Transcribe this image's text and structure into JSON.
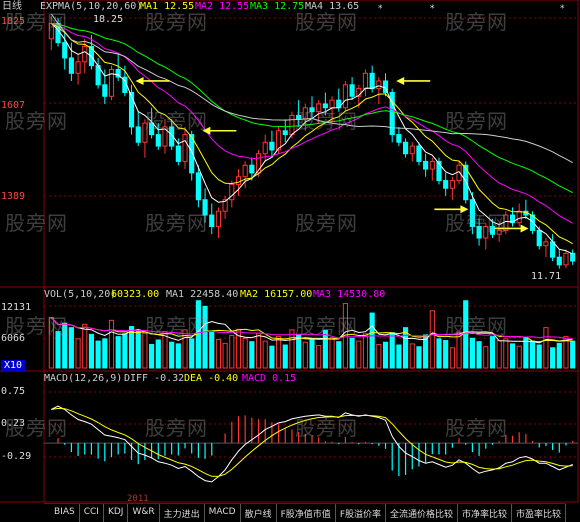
{
  "chart_title": {
    "period": "日线",
    "ma_header": "EXPMA(5,10,20,60)",
    "ma1": "MA1 12.55",
    "ma2": "MA2 12.55",
    "ma3": "MA3 12.75",
    "ma4": "MA4 13.65"
  },
  "price_axis": {
    "top": "1825",
    "mid": "1607",
    "low": "1389"
  },
  "price_annotations": {
    "high": "18.25",
    "low": "11.71"
  },
  "volume_header": {
    "name": "VOL(5,10,20)",
    "vol": "60323.00",
    "ma1": "MA1 22458.40",
    "ma2": "MA2 16157.00",
    "ma3": "MA3 14530.80"
  },
  "volume_axis": {
    "top": "12131",
    "mid": "6066",
    "unit": "X10"
  },
  "macd_header": {
    "name": "MACD(12,26,9)",
    "diff": "DIFF -0.32",
    "dea": "DEA -0.40",
    "macd": "MACD 0.15"
  },
  "macd_axis": {
    "top": "0.75",
    "mid": "0.23",
    "low": "-0.29"
  },
  "watermark": "股旁网",
  "year_label": "2011",
  "tabs": [
    "BIAS",
    "CCI",
    "KDJ",
    "W&R",
    "主力进出",
    "MACD",
    "散户线",
    "F股净值市值",
    "F股溢价率",
    "全流通价格比较",
    "市净率比较",
    "市盈率比较"
  ],
  "colors": {
    "up": "#ff3333",
    "down": "#00ffff",
    "ma1": "#ffffff",
    "ma2": "#ffff00",
    "ma3": "#ff00ff",
    "ma4": "#00ff00",
    "ma_long": "#cccccc",
    "arrow": "#ffff33",
    "grid": "#8b0000"
  },
  "chart_data": {
    "type": "candlestick",
    "y_range": [
      11.3,
      18.4
    ],
    "candles": [
      [
        17.7,
        18.3,
        17.4,
        18.1
      ],
      [
        18.1,
        18.25,
        17.5,
        17.6
      ],
      [
        17.6,
        17.9,
        16.9,
        17.2
      ],
      [
        17.2,
        17.6,
        16.6,
        16.8
      ],
      [
        16.8,
        17.3,
        16.5,
        17.1
      ],
      [
        17.1,
        17.7,
        16.8,
        17.5
      ],
      [
        17.5,
        17.8,
        16.9,
        17.0
      ],
      [
        17.0,
        17.2,
        16.4,
        16.5
      ],
      [
        16.5,
        16.9,
        16.0,
        16.2
      ],
      [
        16.2,
        17.0,
        16.1,
        16.9
      ],
      [
        16.9,
        17.3,
        16.6,
        16.7
      ],
      [
        16.7,
        17.0,
        16.2,
        16.3
      ],
      [
        16.3,
        16.5,
        15.2,
        15.4
      ],
      [
        15.4,
        15.8,
        14.9,
        15.0
      ],
      [
        15.0,
        15.6,
        14.6,
        15.5
      ],
      [
        15.5,
        15.9,
        15.1,
        15.2
      ],
      [
        15.2,
        15.5,
        14.8,
        14.9
      ],
      [
        14.9,
        15.6,
        14.7,
        15.4
      ],
      [
        15.4,
        15.6,
        14.8,
        14.9
      ],
      [
        14.9,
        15.1,
        14.4,
        14.5
      ],
      [
        14.5,
        15.4,
        14.3,
        15.2
      ],
      [
        15.2,
        15.3,
        14.0,
        14.2
      ],
      [
        14.2,
        14.4,
        13.3,
        13.5
      ],
      [
        13.5,
        13.8,
        12.9,
        13.1
      ],
      [
        13.1,
        13.4,
        12.6,
        12.8
      ],
      [
        12.8,
        13.3,
        12.5,
        13.2
      ],
      [
        13.2,
        13.6,
        13.0,
        13.5
      ],
      [
        13.5,
        14.0,
        13.3,
        13.9
      ],
      [
        13.9,
        14.3,
        13.6,
        14.1
      ],
      [
        14.1,
        14.5,
        13.8,
        14.4
      ],
      [
        14.4,
        14.6,
        14.0,
        14.2
      ],
      [
        14.2,
        14.8,
        14.1,
        14.7
      ],
      [
        14.7,
        15.2,
        14.5,
        15.0
      ],
      [
        15.0,
        15.3,
        14.6,
        14.8
      ],
      [
        14.8,
        15.4,
        14.7,
        15.3
      ],
      [
        15.3,
        15.6,
        15.0,
        15.2
      ],
      [
        15.2,
        15.8,
        15.1,
        15.7
      ],
      [
        15.7,
        16.1,
        15.4,
        15.6
      ],
      [
        15.6,
        16.0,
        15.3,
        15.9
      ],
      [
        15.9,
        16.2,
        15.6,
        15.8
      ],
      [
        15.8,
        16.1,
        15.5,
        16.0
      ],
      [
        16.0,
        16.3,
        15.7,
        15.9
      ],
      [
        15.9,
        16.2,
        15.5,
        16.1
      ],
      [
        16.1,
        16.4,
        15.8,
        15.9
      ],
      [
        15.9,
        16.6,
        15.8,
        16.5
      ],
      [
        16.5,
        16.7,
        16.1,
        16.2
      ],
      [
        16.2,
        16.5,
        15.9,
        16.4
      ],
      [
        16.4,
        16.9,
        16.2,
        16.8
      ],
      [
        16.8,
        17.0,
        16.3,
        16.4
      ],
      [
        16.4,
        16.7,
        16.0,
        16.6
      ],
      [
        16.6,
        16.8,
        16.2,
        16.3
      ],
      [
        16.3,
        16.4,
        15.0,
        15.2
      ],
      [
        15.2,
        15.4,
        14.9,
        15.0
      ],
      [
        15.0,
        15.1,
        14.6,
        14.7
      ],
      [
        14.7,
        15.0,
        14.5,
        14.9
      ],
      [
        14.9,
        15.0,
        14.4,
        14.5
      ],
      [
        14.5,
        14.7,
        14.1,
        14.3
      ],
      [
        14.3,
        14.6,
        14.0,
        14.5
      ],
      [
        14.5,
        14.6,
        13.9,
        14.0
      ],
      [
        14.0,
        14.2,
        13.6,
        13.8
      ],
      [
        13.8,
        14.1,
        13.5,
        14.0
      ],
      [
        14.0,
        14.5,
        13.9,
        14.4
      ],
      [
        14.4,
        14.5,
        13.4,
        13.5
      ],
      [
        13.5,
        13.7,
        12.6,
        12.8
      ],
      [
        12.8,
        13.0,
        12.3,
        12.5
      ],
      [
        12.5,
        12.9,
        12.2,
        12.8
      ],
      [
        12.8,
        13.0,
        12.5,
        12.6
      ],
      [
        12.6,
        12.9,
        12.4,
        12.7
      ],
      [
        12.7,
        13.2,
        12.6,
        13.1
      ],
      [
        13.1,
        13.3,
        12.8,
        12.9
      ],
      [
        12.9,
        13.4,
        12.8,
        13.2
      ],
      [
        13.2,
        13.5,
        13.0,
        13.1
      ],
      [
        13.1,
        13.2,
        12.6,
        12.7
      ],
      [
        12.7,
        12.8,
        12.2,
        12.3
      ],
      [
        12.3,
        12.5,
        12.0,
        12.4
      ],
      [
        12.4,
        12.6,
        11.9,
        12.0
      ],
      [
        12.0,
        12.2,
        11.7,
        11.8
      ],
      [
        11.8,
        12.2,
        11.71,
        12.1
      ],
      [
        12.1,
        12.2,
        11.8,
        11.9
      ]
    ],
    "volume_range": [
      0,
      12131
    ],
    "volume": [
      9000,
      6500,
      8000,
      7200,
      5200,
      7800,
      6000,
      4800,
      5200,
      8500,
      5600,
      6100,
      7400,
      6800,
      6200,
      4200,
      5000,
      6500,
      4600,
      4300,
      6800,
      5200,
      12000,
      11000,
      6500,
      5100,
      4400,
      5800,
      6900,
      5300,
      4700,
      6200,
      4800,
      3900,
      5600,
      4100,
      6800,
      5900,
      4600,
      5100,
      4000,
      6700,
      5400,
      4700,
      11500,
      5300,
      4800,
      6100,
      9800,
      4200,
      4600,
      6300,
      4100,
      7200,
      4300,
      3800,
      5900,
      10200,
      5200,
      4900,
      3600,
      6400,
      12000,
      5300,
      4700,
      3800,
      5600,
      4900,
      5200,
      4300,
      3900,
      5400,
      4800,
      4100,
      7200,
      3600,
      4400,
      5600,
      4800
    ],
    "macd_range": [
      -0.7,
      0.85
    ],
    "macd": [
      0.5,
      0.55,
      0.5,
      0.42,
      0.35,
      0.32,
      0.28,
      0.2,
      0.12,
      0.1,
      0.08,
      0.05,
      -0.05,
      -0.15,
      -0.18,
      -0.22,
      -0.28,
      -0.3,
      -0.33,
      -0.38,
      -0.35,
      -0.42,
      -0.5,
      -0.56,
      -0.58,
      -0.5,
      -0.4,
      -0.25,
      -0.12,
      -0.02,
      0.05,
      0.12,
      0.2,
      0.25,
      0.3,
      0.32,
      0.36,
      0.38,
      0.4,
      0.41,
      0.42,
      0.4,
      0.4,
      0.38,
      0.45,
      0.42,
      0.4,
      0.42,
      0.4,
      0.38,
      0.34,
      0.1,
      -0.05,
      -0.15,
      -0.2,
      -0.26,
      -0.3,
      -0.28,
      -0.32,
      -0.36,
      -0.33,
      -0.25,
      -0.3,
      -0.38,
      -0.45,
      -0.42,
      -0.4,
      -0.37,
      -0.3,
      -0.28,
      -0.22,
      -0.2,
      -0.24,
      -0.3,
      -0.3,
      -0.35,
      -0.4,
      -0.36,
      -0.32
    ]
  }
}
